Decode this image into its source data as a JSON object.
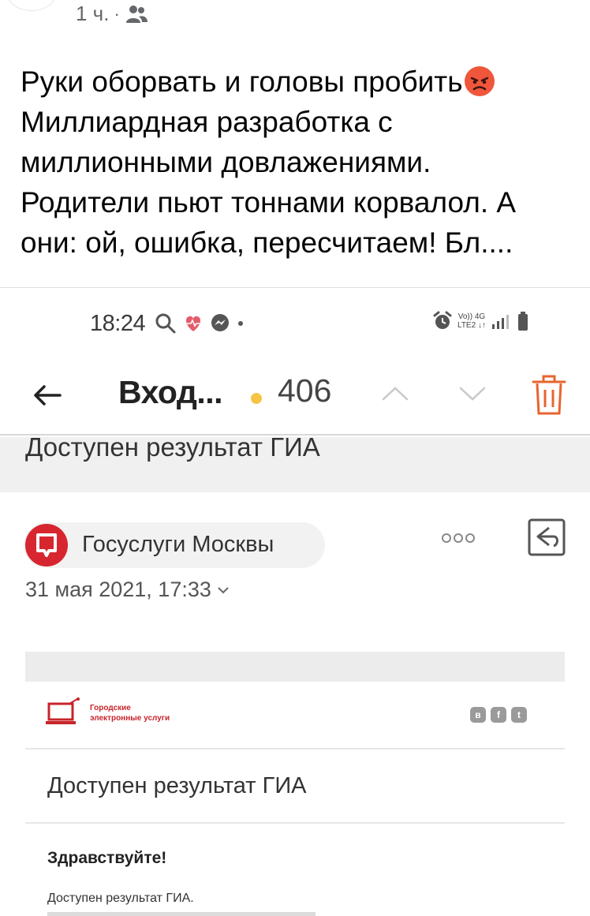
{
  "post": {
    "time": "1 ч.",
    "separator": "·",
    "audience_icon": "friends-icon",
    "text_lines": [
      "Руки оборвать и головы пробить",
      "Миллиардная разработка с",
      "миллионными довлажениями.",
      "Родители пьют тоннами корвалол.  А",
      "они: ой, ошибка, пересчитаем! Бл...."
    ],
    "emoji": "angry-face-emoji"
  },
  "screenshot": {
    "status_bar": {
      "time": "18:24",
      "net_top": "Vo)) 4G",
      "net_bottom": "LTE2 ↓↑"
    },
    "toolbar": {
      "folder": "Вход...",
      "unread_count": "406"
    },
    "subject": "Доступен результат ГИА",
    "sender": "Госуслуги Москвы",
    "date": "31 мая 2021, 17:33",
    "letter": {
      "logo_line1": "Городские",
      "logo_line2": "электронные услуги",
      "title": "Доступен результат ГИА",
      "greeting": "Здравствуйте!",
      "body": "Доступен результат ГИА."
    },
    "colors": {
      "sender_avatar": "#d7262f",
      "unread_dot": "#f6c445",
      "trash_accent": "#e8642f",
      "brand": "#c8242b"
    }
  }
}
